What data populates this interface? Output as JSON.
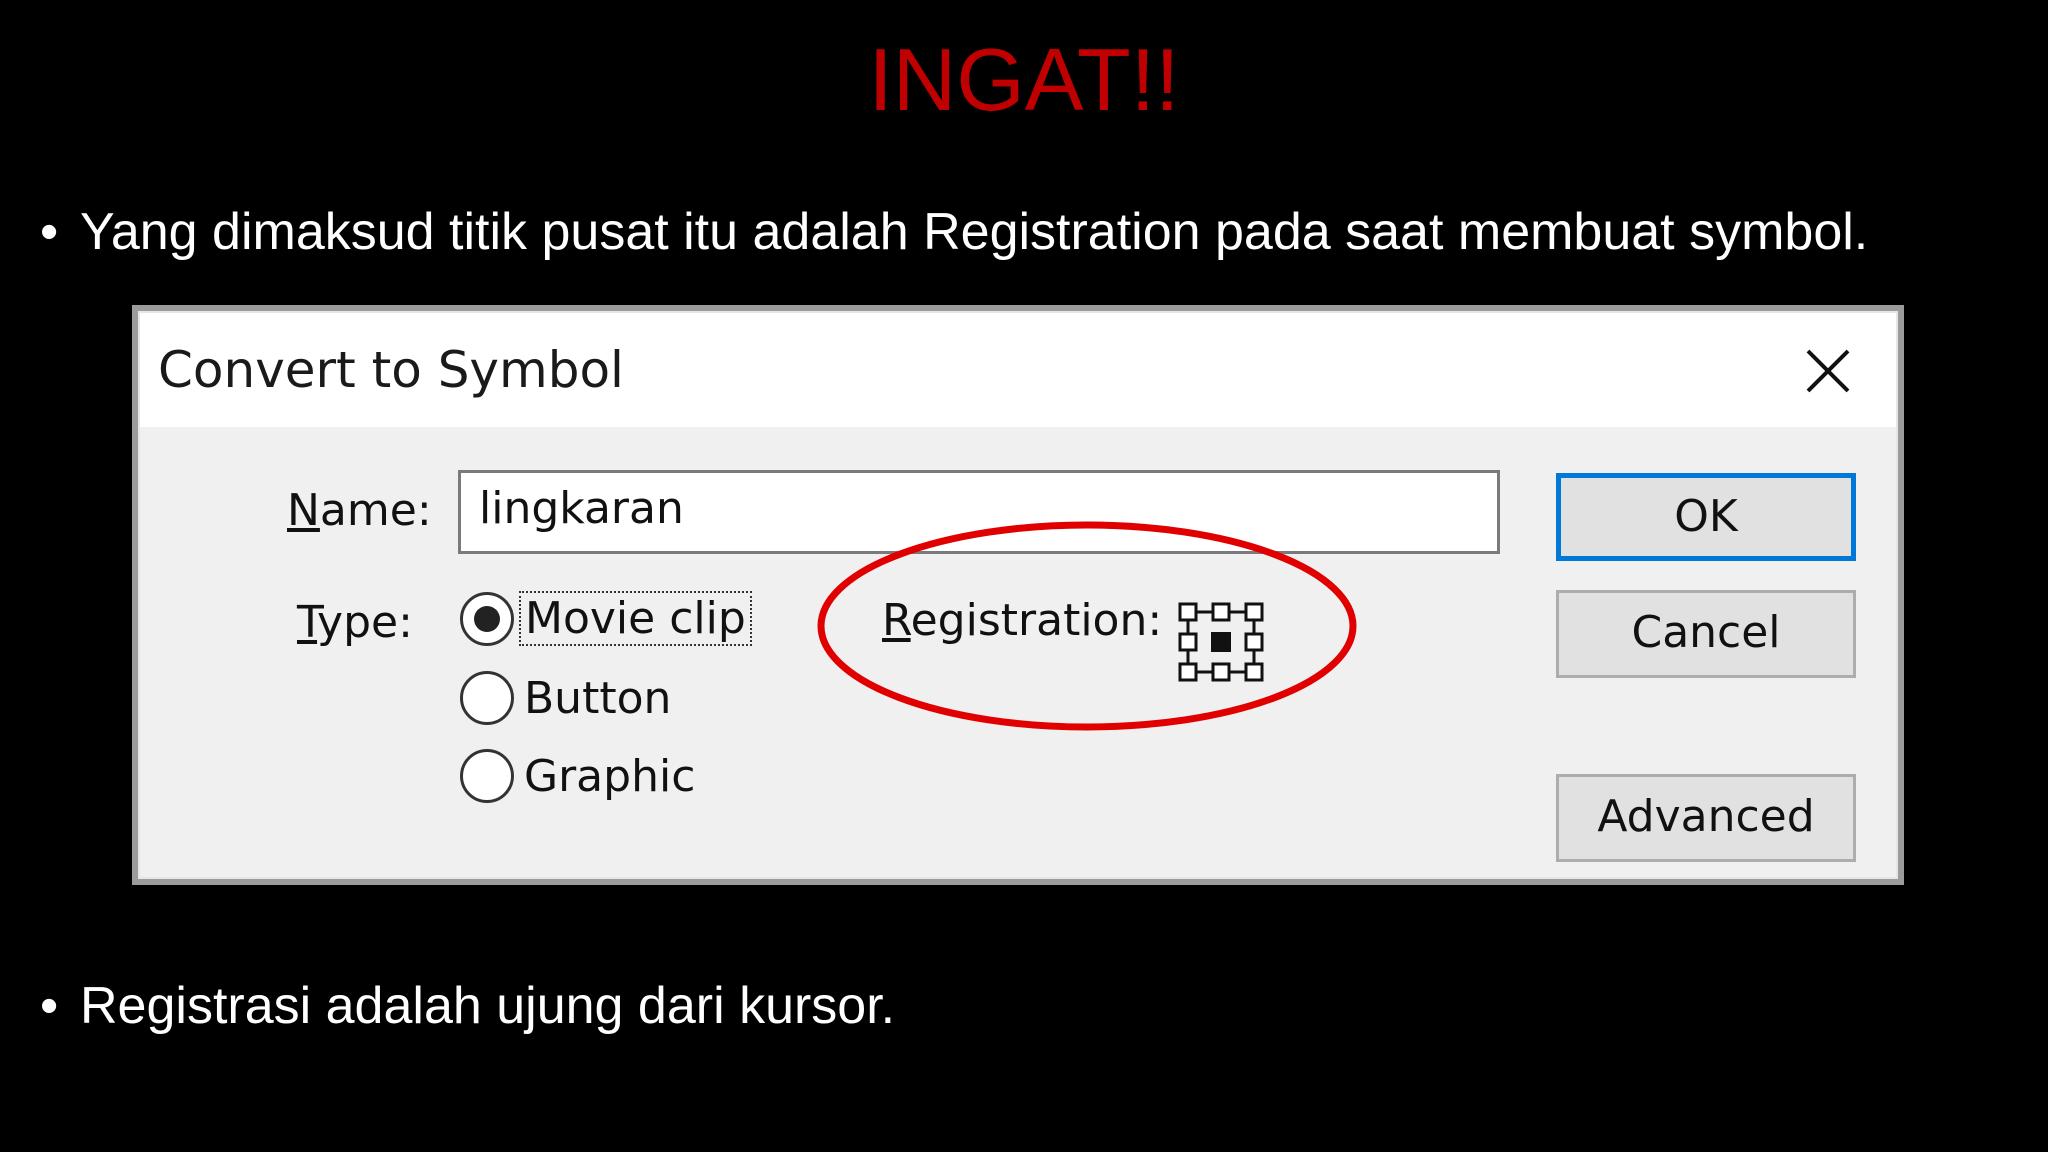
{
  "slide": {
    "title": "INGAT!!",
    "bullet_symbol": "•",
    "bullet_1": "Yang dimaksud titik pusat itu adalah Registration pada saat membuat symbol.",
    "bullet_2": "Registrasi adalah ujung dari kursor."
  },
  "dialog": {
    "title": "Convert to Symbol",
    "name_label_u": "N",
    "name_label_rest": "ame:",
    "name_value": "lingkaran",
    "type_label_u": "T",
    "type_label_rest": "ype:",
    "types": [
      {
        "label": "Movie clip",
        "checked": true
      },
      {
        "label": "Button",
        "checked": false
      },
      {
        "label": "Graphic",
        "checked": false
      }
    ],
    "registration_label_u": "R",
    "registration_label_rest": "egistration:",
    "buttons": {
      "ok": "OK",
      "cancel": "Cancel",
      "advanced": "Advanced"
    }
  },
  "colors": {
    "title": "#c00000",
    "annotation": "#e00000",
    "ok_border": "#0078d7"
  }
}
